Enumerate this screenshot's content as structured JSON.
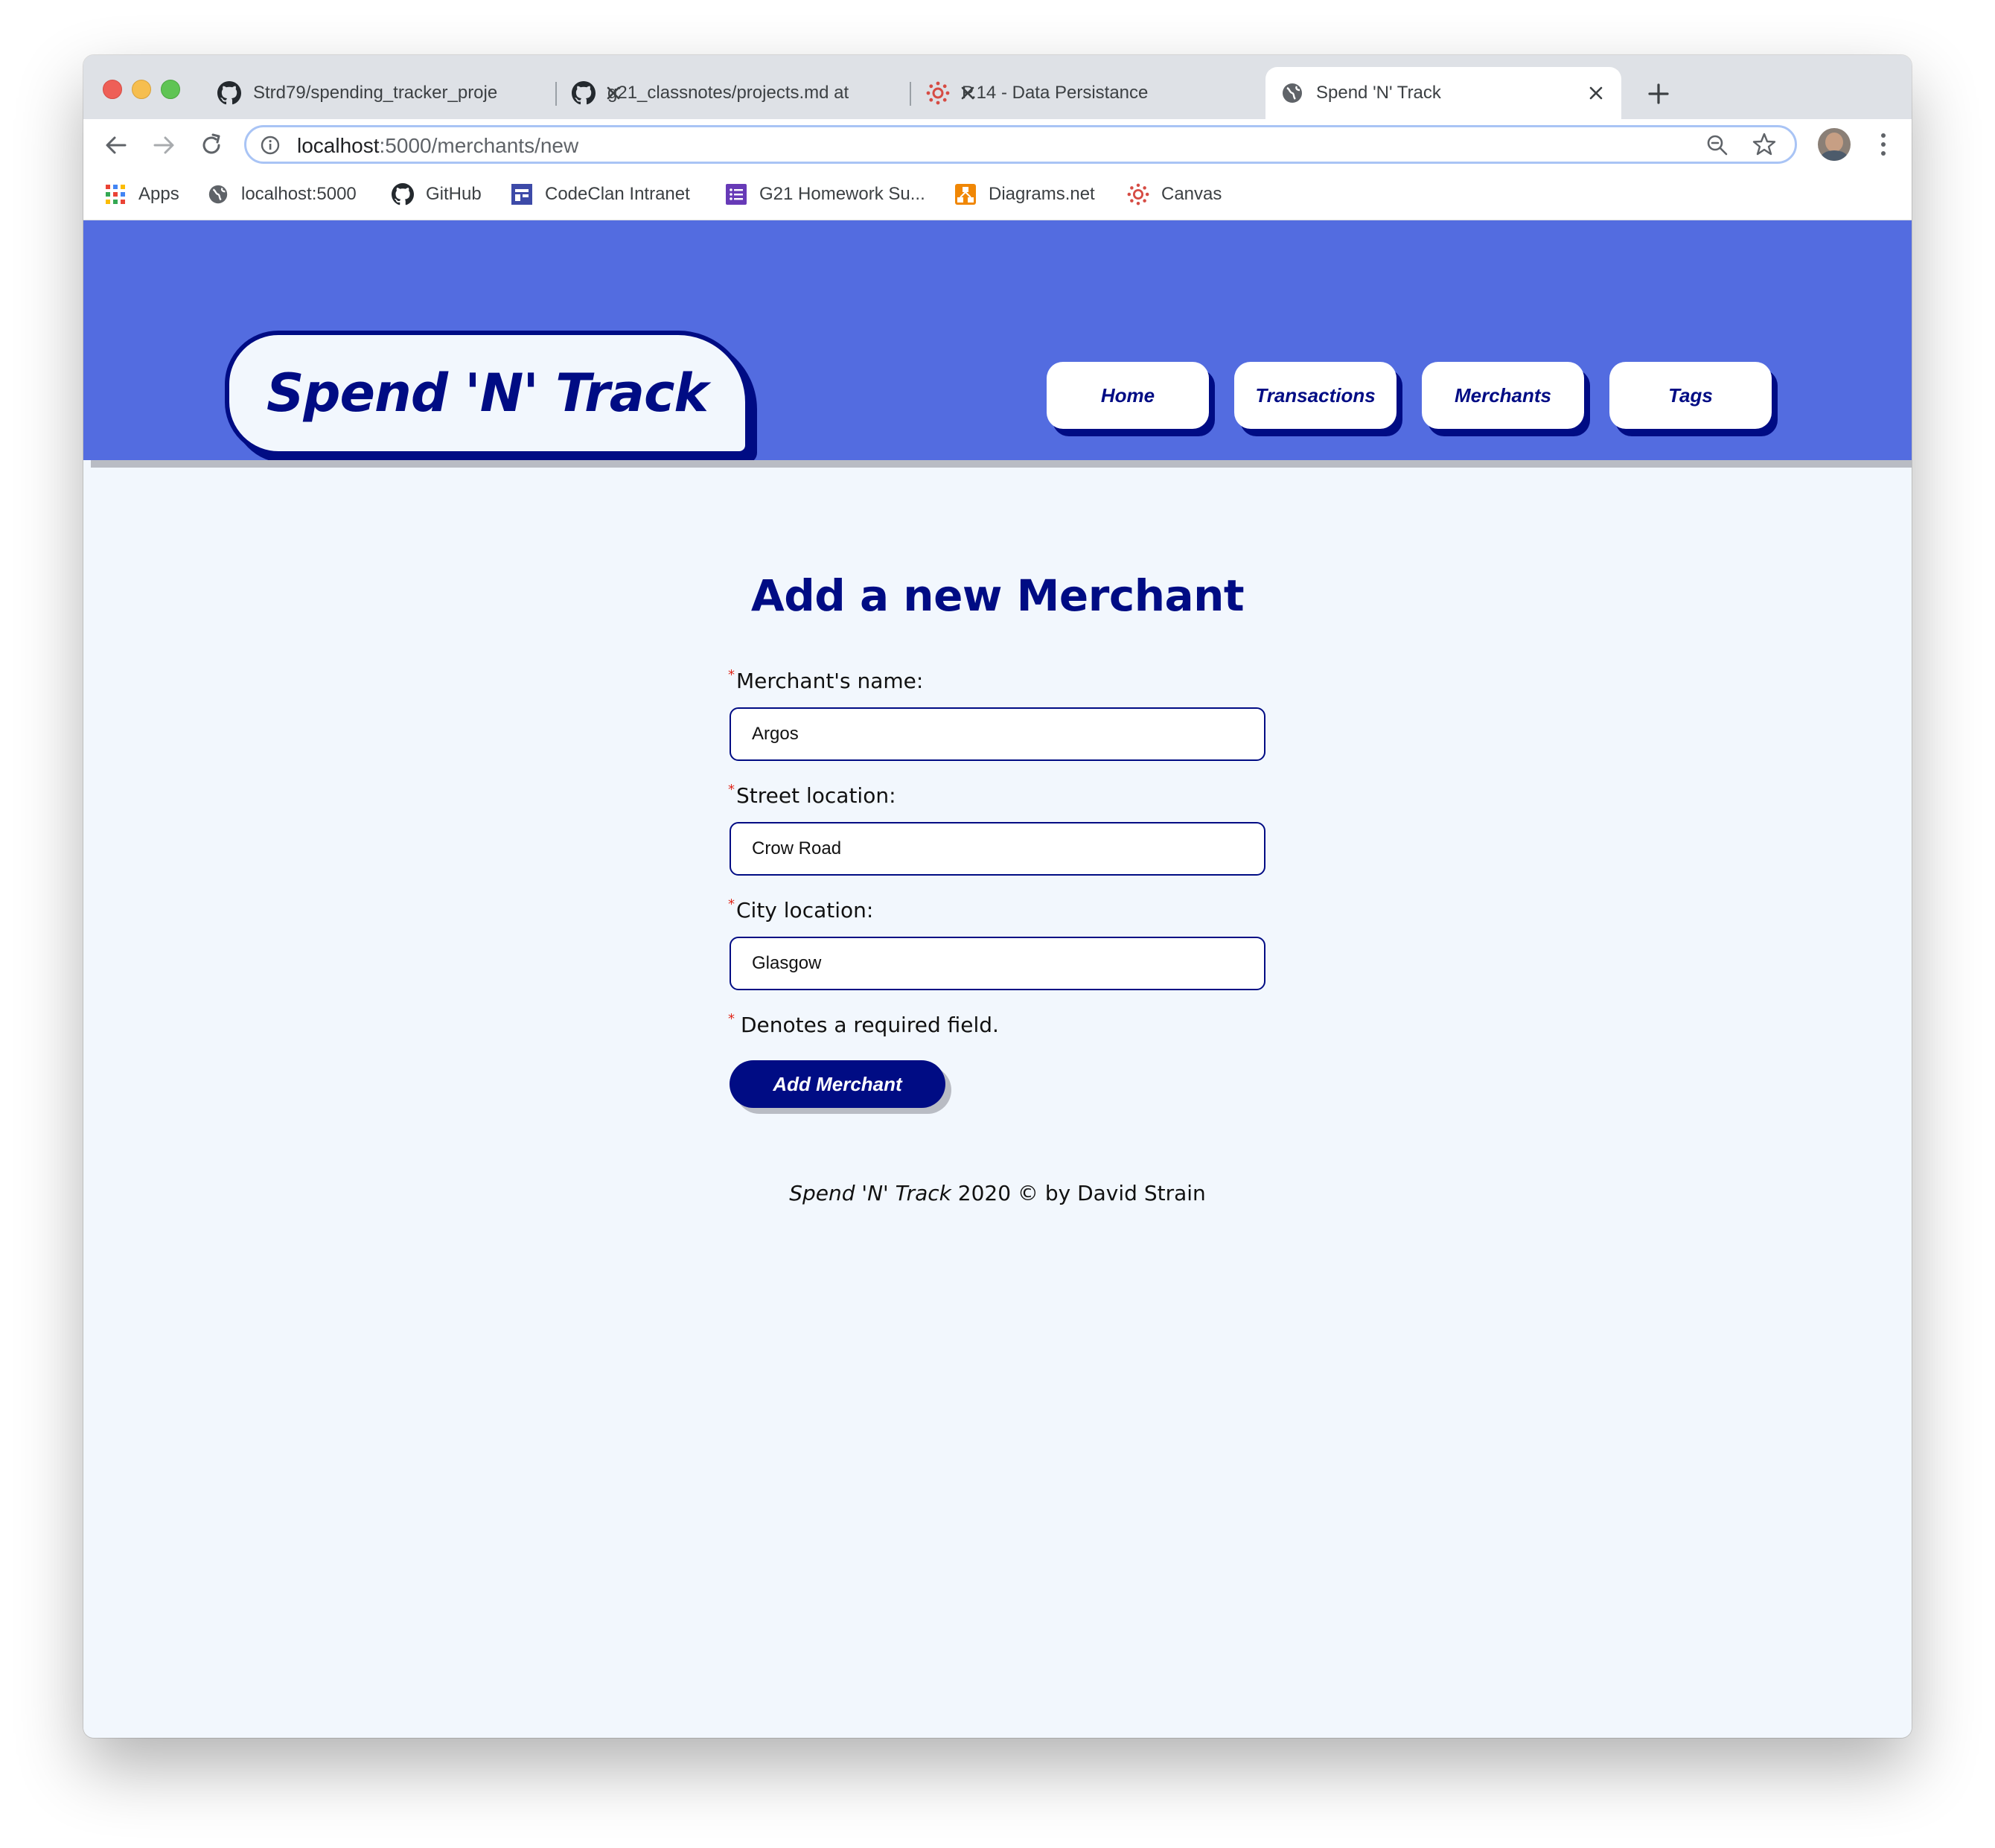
{
  "browser": {
    "tabs": [
      {
        "title": "Strd79/spending_tracker_proje",
        "icon": "github-icon",
        "active": false
      },
      {
        "title": "g21_classnotes/projects.md at",
        "icon": "github-icon",
        "active": false
      },
      {
        "title": "P.14 - Data Persistance",
        "icon": "canvas-icon",
        "active": false
      },
      {
        "title": "Spend 'N' Track",
        "icon": "globe-icon",
        "active": true
      }
    ],
    "url_host": "localhost",
    "url_path": ":5000/merchants/new",
    "bookmarks": [
      {
        "label": "Apps",
        "icon": "apps-grid-icon"
      },
      {
        "label": "localhost:5000",
        "icon": "globe-icon"
      },
      {
        "label": "GitHub",
        "icon": "github-icon"
      },
      {
        "label": "CodeClan Intranet",
        "icon": "intranet-icon"
      },
      {
        "label": "G21 Homework Su...",
        "icon": "forms-icon"
      },
      {
        "label": "Diagrams.net",
        "icon": "diagrams-icon"
      },
      {
        "label": "Canvas",
        "icon": "canvas-icon"
      }
    ]
  },
  "site": {
    "logo": "Spend 'N' Track",
    "nav": [
      "Home",
      "Transactions",
      "Merchants",
      "Tags"
    ],
    "brand_color": "#536ce0",
    "accent_color": "#000c84"
  },
  "form": {
    "title": "Add a new Merchant",
    "required_marker": "*",
    "fields": [
      {
        "label": "Merchant's name:",
        "value": "Argos"
      },
      {
        "label": "Street location:",
        "value": "Crow Road"
      },
      {
        "label": "City location:",
        "value": "Glasgow"
      }
    ],
    "required_note": "Denotes a required field.",
    "submit_label": "Add Merchant"
  },
  "footer": {
    "brand": "Spend 'N' Track",
    "text": " 2020 © by David Strain"
  }
}
